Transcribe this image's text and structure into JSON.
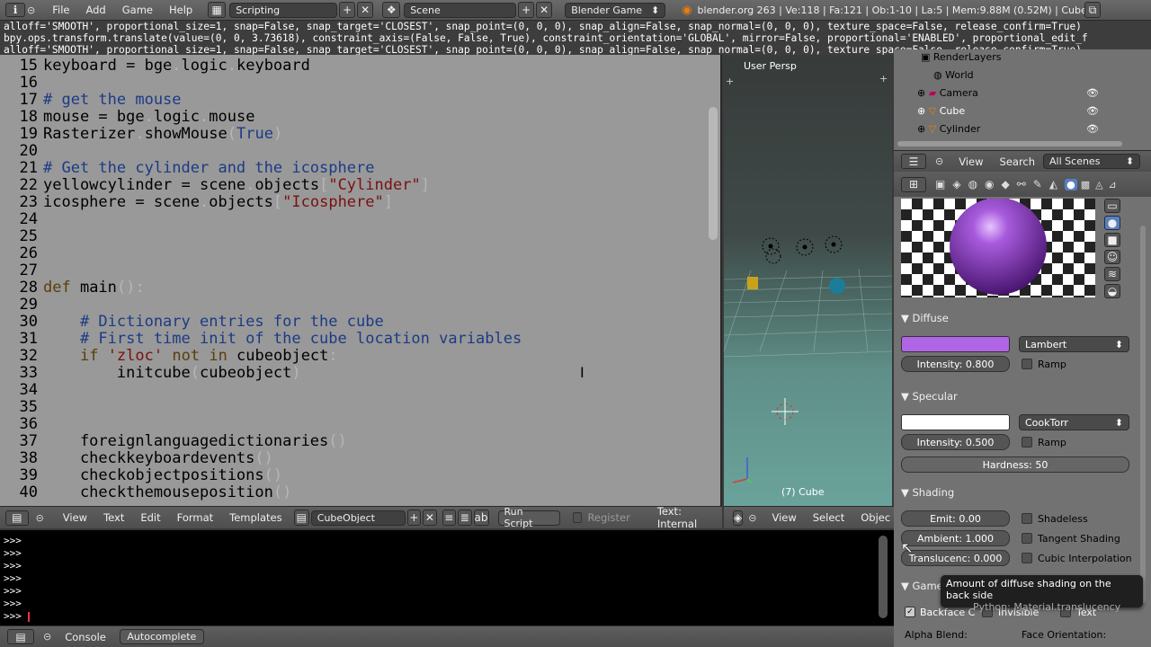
{
  "topbar": {
    "menus": [
      "File",
      "Add",
      "Game",
      "Help"
    ],
    "layout_name": "Scripting",
    "scene_name": "Scene",
    "engine": "Blender Game",
    "stats": "blender.org 263 | Ve:118 | Fa:121 | Ob:1-10 | La:5 | Mem:9.88M (0.52M) | Cube"
  },
  "infolog": [
    "alloff='SMOOTH', proportional_size=1, snap=False, snap_target='CLOSEST', snap_point=(0, 0, 0), snap_align=False, snap_normal=(0, 0, 0), texture_space=False, release_confirm=True)",
    "bpy.ops.transform.translate(value=(0, 0, 3.73618), constraint_axis=(False, False, True), constraint_orientation='GLOBAL', mirror=False, proportional='ENABLED', proportional_edit_f",
    "alloff='SMOOTH', proportional_size=1, snap=False, snap_target='CLOSEST', snap_point=(0, 0, 0), snap_align=False, snap_normal=(0, 0, 0), texture_space=False, release_confirm=True)"
  ],
  "editor": {
    "lines": [
      {
        "n": "15",
        "t": "keyboard = bge.logic.keyboard"
      },
      {
        "n": "16",
        "t": ""
      },
      {
        "n": "17",
        "t": "# get the mouse"
      },
      {
        "n": "18",
        "t": "mouse = bge.logic.mouse"
      },
      {
        "n": "19",
        "t": "Rasterizer.showMouse(True)"
      },
      {
        "n": "20",
        "t": ""
      },
      {
        "n": "21",
        "t": "# Get the cylinder and the icosphere"
      },
      {
        "n": "22",
        "t": "yellowcylinder = scene.objects[\"Cylinder\"]"
      },
      {
        "n": "23",
        "t": "icosphere = scene.objects[\"Icosphere\"]"
      },
      {
        "n": "24",
        "t": ""
      },
      {
        "n": "25",
        "t": ""
      },
      {
        "n": "26",
        "t": ""
      },
      {
        "n": "27",
        "t": ""
      },
      {
        "n": "28",
        "t": "def main():"
      },
      {
        "n": "29",
        "t": ""
      },
      {
        "n": "30",
        "t": "    # Dictionary entries for the cube"
      },
      {
        "n": "31",
        "t": "    # First time init of the cube location variables"
      },
      {
        "n": "32",
        "t": "    if 'zloc' not in cubeobject:"
      },
      {
        "n": "33",
        "t": "        initcube(cubeobject)"
      },
      {
        "n": "34",
        "t": ""
      },
      {
        "n": "35",
        "t": ""
      },
      {
        "n": "36",
        "t": ""
      },
      {
        "n": "37",
        "t": "    foreignlanguagedictionaries()"
      },
      {
        "n": "38",
        "t": "    checkkeyboardevents()"
      },
      {
        "n": "39",
        "t": "    checkobjectpositions()"
      },
      {
        "n": "40",
        "t": "    checkthemouseposition()"
      }
    ],
    "header": {
      "menus": [
        "View",
        "Text",
        "Edit",
        "Format",
        "Templates"
      ],
      "text_name": "CubeObject",
      "run_script": "Run Script",
      "register": "Register",
      "location": "Text: Internal"
    }
  },
  "viewport": {
    "label": "User Persp",
    "object_label": "(7) Cube",
    "header_menus": [
      "View",
      "Select",
      "Objec"
    ]
  },
  "outliner": {
    "items": [
      "RenderLayers",
      "World",
      "Camera",
      "Cube",
      "Cylinder"
    ],
    "header": {
      "view": "View",
      "search": "Search",
      "scenes": "All Scenes"
    }
  },
  "material": {
    "diffuse": {
      "title": "Diffuse",
      "color": "#b064e6",
      "shader": "Lambert",
      "intensity": "Intensity: 0.800",
      "ramp": "Ramp"
    },
    "specular": {
      "title": "Specular",
      "color": "#ffffff",
      "shader": "CookTorr",
      "intensity": "Intensity: 0.500",
      "ramp": "Ramp",
      "hardness": "Hardness: 50"
    },
    "shading": {
      "title": "Shading",
      "emit": "Emit: 0.00",
      "ambient": "Ambient: 1.000",
      "translucency": "Translucenc: 0.000",
      "shadeless": "Shadeless",
      "tangent": "Tangent Shading",
      "cubic": "Cubic Interpolation"
    },
    "game": {
      "title": "Game",
      "backface": "Backface C",
      "invisible": "Invisible",
      "text": "Text",
      "alpha_blend": "Alpha Blend:",
      "face_orientation": "Face Orientation:"
    }
  },
  "tooltip": {
    "text": "Amount of diffuse shading on the back side",
    "python": "Python: Material.translucency"
  },
  "console": {
    "prompts": [
      ">>>",
      ">>>",
      ">>>",
      ">>>",
      ">>>",
      ">>>",
      ">>>"
    ],
    "tabs": [
      "Console",
      "Autocomplete"
    ]
  }
}
